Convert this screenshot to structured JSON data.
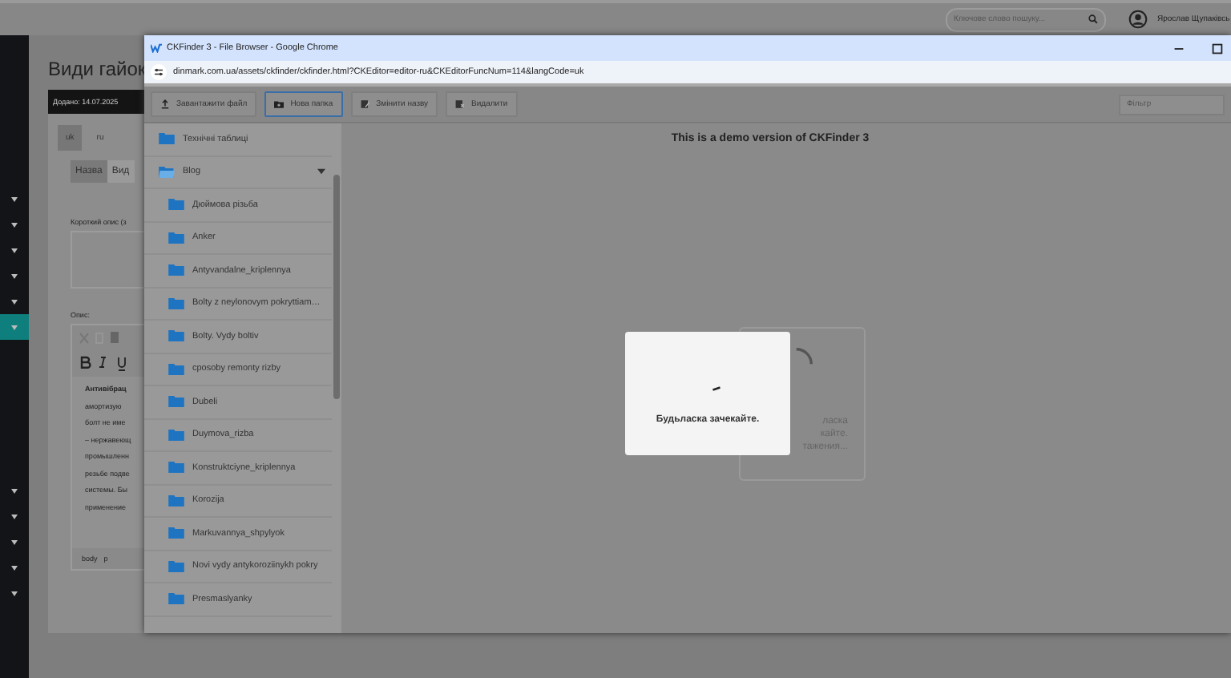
{
  "page": {
    "search": {
      "placeholder": "Ключове слово пошуку..."
    },
    "user_name": "Ярослав Щупаківсь",
    "title": "Види гайок",
    "added_badge": "Додано: 14.07.2025",
    "language_tabs": [
      {
        "label": "uk",
        "selected": true
      },
      {
        "label": "ru",
        "selected": false
      }
    ],
    "field_tabs": [
      {
        "label": "Назва",
        "selected": true
      },
      {
        "label": "Вид",
        "selected": false
      }
    ],
    "short_description_label": "Короткий опис (з",
    "description_label": "Опис:",
    "editor_lines": [
      {
        "text": "Антивібрац",
        "bold": true
      },
      {
        "text": "амортизую",
        "bold": false
      },
      {
        "text": "болт не име",
        "bold": false
      },
      {
        "text": "– нержавеющ",
        "bold": false
      },
      {
        "text": "промышленн",
        "bold": false
      },
      {
        "text": "резьбе подве",
        "bold": false
      },
      {
        "text": "системы. Бы",
        "bold": false
      },
      {
        "text": "применение",
        "bold": false
      }
    ],
    "editor_path": [
      "body",
      "p"
    ],
    "sidebar_items": [
      {
        "selected": false
      },
      {
        "selected": false
      },
      {
        "selected": false
      },
      {
        "selected": false
      },
      {
        "selected": false
      },
      {
        "selected": true
      },
      {
        "selected": false
      },
      {
        "selected": false
      },
      {
        "selected": false
      },
      {
        "selected": false
      },
      {
        "selected": false
      }
    ]
  },
  "popup": {
    "title": "CKFinder 3 - File Browser - Google Chrome",
    "url": "dinmark.com.ua/assets/ckfinder/ckfinder.html?CKEditor=editor-ru&CKEditorFuncNum=114&langCode=uk",
    "toolbar": [
      {
        "label": "Завантажити файл",
        "kind": "upload",
        "selected": false
      },
      {
        "label": "Нова папка",
        "kind": "new-folder",
        "selected": true
      },
      {
        "label": "Змінити назву",
        "kind": "rename",
        "selected": false
      },
      {
        "label": "Видалити",
        "kind": "delete",
        "selected": false
      }
    ],
    "filter": {
      "placeholder": "Фільтр"
    },
    "folders": [
      {
        "label": "Технічні таблиці",
        "expanded": false
      },
      {
        "label": "Blog",
        "expanded": true,
        "children": [
          {
            "label": "Дюймова різьба"
          },
          {
            "label": "Anker"
          },
          {
            "label": "Antyvandalne_kriplennya"
          },
          {
            "label": "Bolty z neylonovym pokryttiam…"
          },
          {
            "label": "Bolty. Vydy boltiv"
          },
          {
            "label": "cposoby remonty rizby"
          },
          {
            "label": "Dubeli"
          },
          {
            "label": "Duymova_rizba"
          },
          {
            "label": "Konstruktciyne_kriplennya"
          },
          {
            "label": "Korozija"
          },
          {
            "label": "Markuvannya_shpylyok"
          },
          {
            "label": "Novi vydy antykoroziinykh pokry"
          },
          {
            "label": "Presmaslyanky"
          }
        ]
      }
    ],
    "demo_notice": "This is a demo version of CKFinder 3",
    "loading_card": [
      "ласка",
      "кайте.",
      "тажения..."
    ],
    "dialog": {
      "message": "Будьласка зачекайте."
    }
  }
}
